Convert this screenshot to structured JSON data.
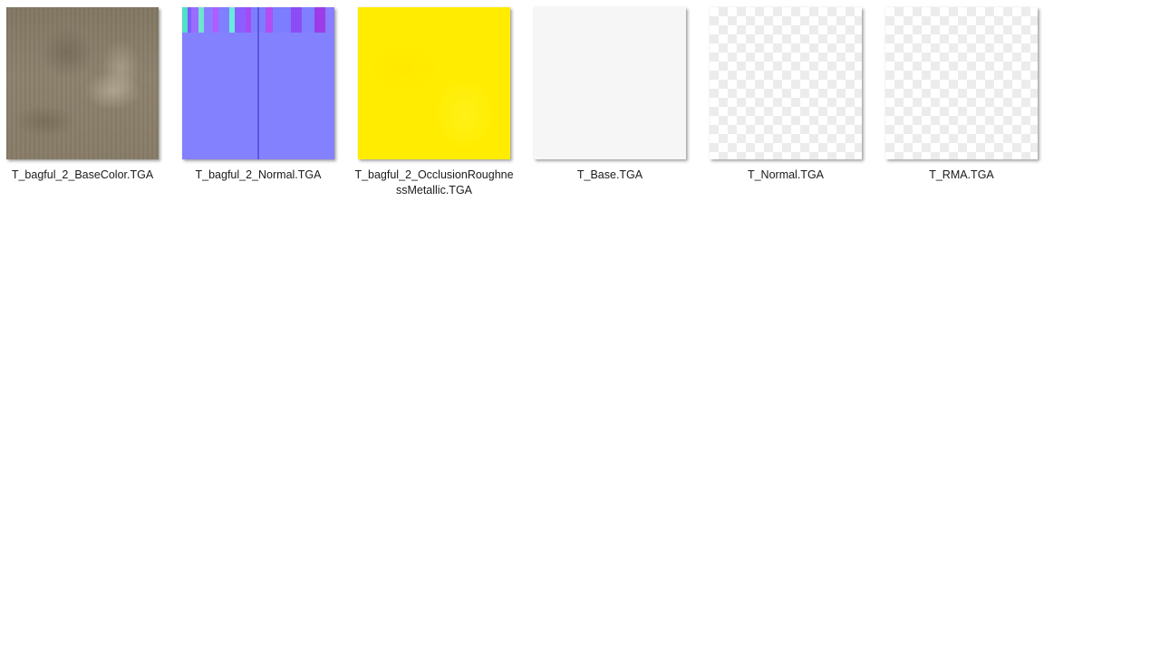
{
  "files": [
    {
      "name": "T_bagful_2_BaseColor.TGA",
      "thumb": "basecolor"
    },
    {
      "name": "T_bagful_2_Normal.TGA",
      "thumb": "normal"
    },
    {
      "name": "T_bagful_2_OcclusionRoughnessMetallic.TGA",
      "thumb": "rma"
    },
    {
      "name": "T_Base.TGA",
      "thumb": "white"
    },
    {
      "name": "T_Normal.TGA",
      "thumb": "checker"
    },
    {
      "name": "T_RMA.TGA",
      "thumb": "checker"
    }
  ]
}
